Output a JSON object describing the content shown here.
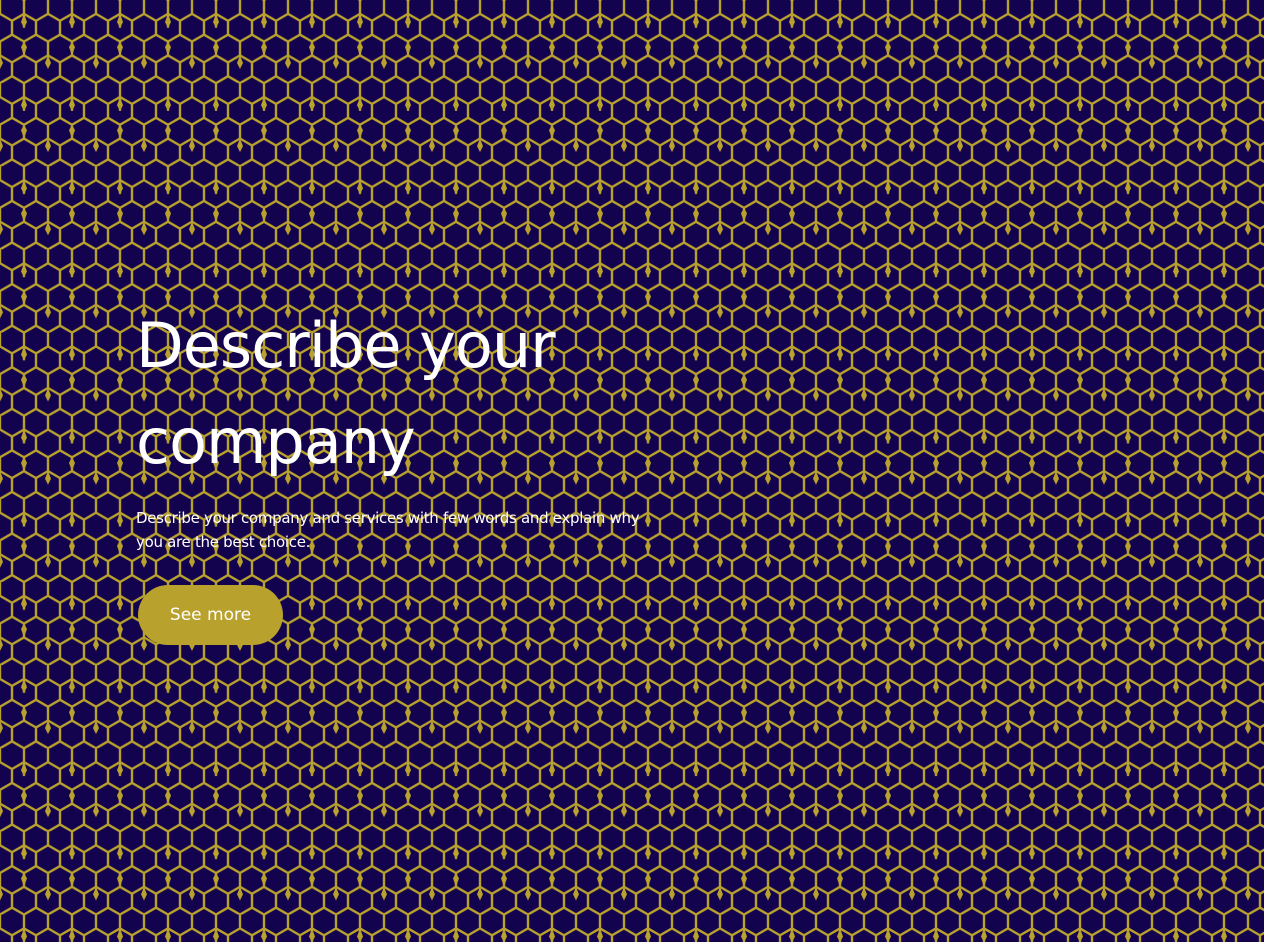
{
  "hero": {
    "headline_line1": "Describe your",
    "headline_line2": "company",
    "description": "Describe your company and services with few words and explain why you are the best choice.",
    "cta_label": "See more"
  },
  "colors": {
    "background": "#13034f",
    "pattern": "#b9a12d",
    "text": "#ffffff",
    "button": "#b9a12d"
  },
  "icons": {
    "background_pattern": "star-lattice-pattern"
  }
}
